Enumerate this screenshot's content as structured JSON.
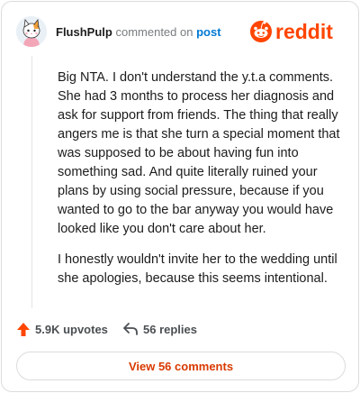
{
  "header": {
    "username": "FlushPulp",
    "action_text": "commented on",
    "post_link": "post",
    "brand_text": "reddit"
  },
  "comment": {
    "paragraphs": [
      "Big NTA. I don't understand the y.t.a comments. She had 3 months to process her diagnosis and ask for support from friends. The thing that really angers me is that she turn a special moment that was supposed to be about having fun into something sad. And quite literally ruined your plans by using social pressure, because if you wanted to go to the bar anyway you would have looked like you don't care about her.",
      "I honestly wouldn't invite her to the wedding until she apologies, because this seems intentional."
    ]
  },
  "actions": {
    "upvotes": "5.9K upvotes",
    "replies": "56 replies"
  },
  "view_button": "View 56 comments",
  "colors": {
    "brand": "#ff4500",
    "link": "#0079d3",
    "button_text": "#d93a00"
  },
  "icons": {
    "avatar": "avatar-cat-icon",
    "brand": "reddit-logo-icon",
    "upvote": "upvote-arrow-icon",
    "reply": "reply-arrow-icon"
  }
}
